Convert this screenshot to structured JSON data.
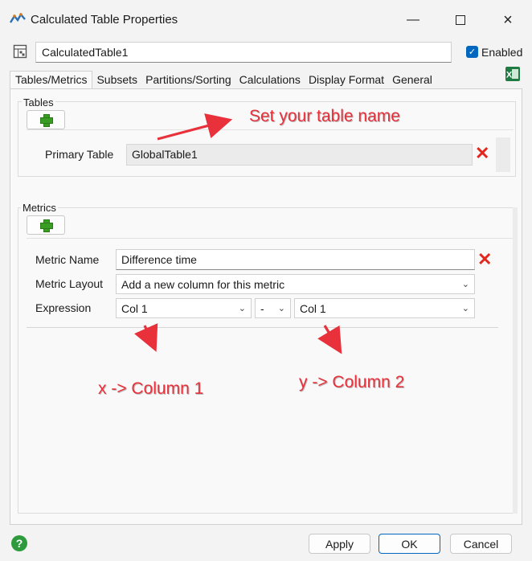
{
  "window": {
    "title": "Calculated Table Properties"
  },
  "object": {
    "name": "CalculatedTable1",
    "enabled_label": "Enabled"
  },
  "tabs": [
    {
      "label": "Tables/Metrics",
      "active": true
    },
    {
      "label": "Subsets"
    },
    {
      "label": "Partitions/Sorting"
    },
    {
      "label": "Calculations"
    },
    {
      "label": "Display Format"
    },
    {
      "label": "General"
    }
  ],
  "tables": {
    "group_label": "Tables",
    "primary_label": "Primary Table",
    "primary_value": "GlobalTable1"
  },
  "metrics": {
    "group_label": "Metrics",
    "name_label": "Metric Name",
    "name_value": "Difference time",
    "layout_label": "Metric Layout",
    "layout_value": "Add a new column for this metric",
    "expression_label": "Expression",
    "expr_left": "Col 1",
    "expr_op": "-",
    "expr_right": "Col 1"
  },
  "annotations": {
    "table_name": "Set your table name",
    "x_col": "x -> Column 1",
    "y_col": "y -> Column 2"
  },
  "footer": {
    "apply": "Apply",
    "ok": "OK",
    "cancel": "Cancel"
  },
  "colors": {
    "accent": "#0067c0",
    "annotation": "#e8313b",
    "delete": "#e0281e"
  }
}
